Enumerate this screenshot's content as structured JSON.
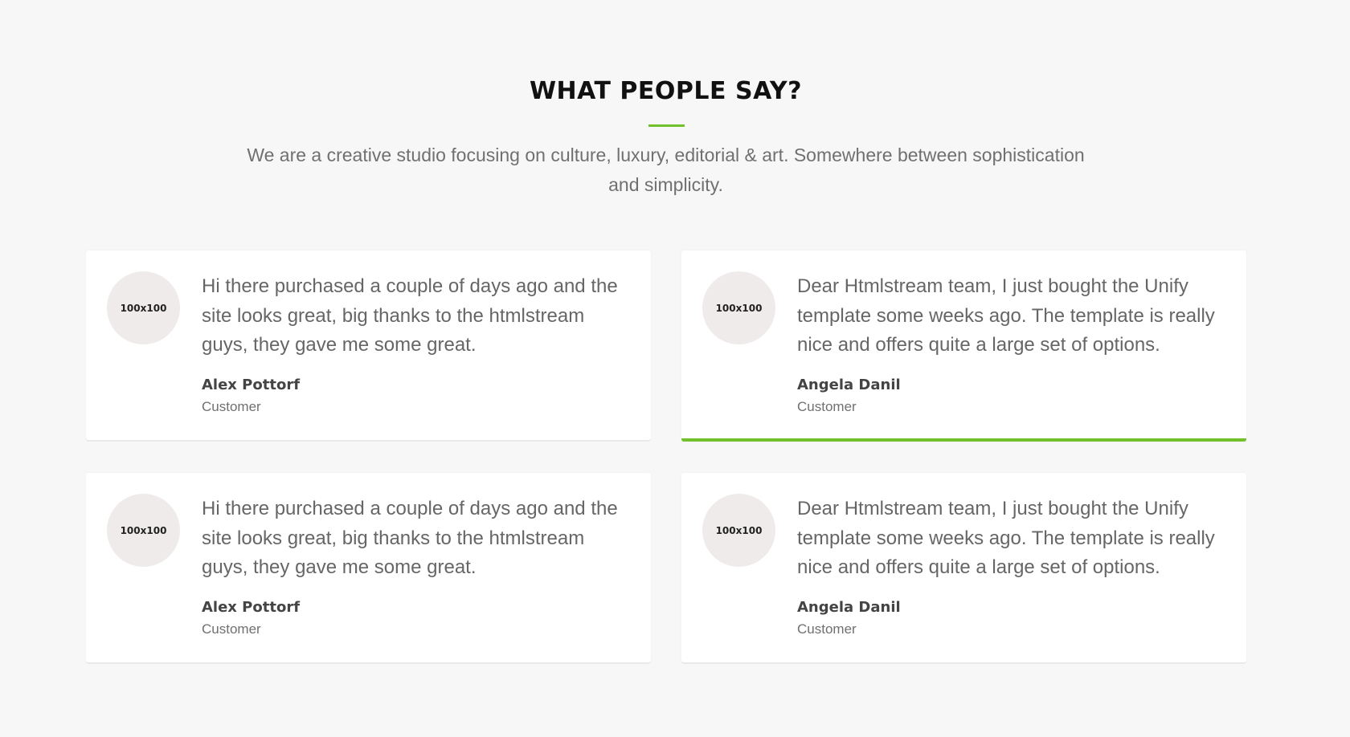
{
  "section": {
    "heading": "WHAT PEOPLE SAY?",
    "intro": "We are a creative studio focusing on culture, luxury, editorial & art. Somewhere between sophistication and simplicity."
  },
  "colors": {
    "accent": "#72c02c",
    "background": "#f7f7f7",
    "card": "#ffffff",
    "avatar_placeholder": "#efebea"
  },
  "testimonials": [
    {
      "avatar_label": "100x100",
      "quote": "Hi there purchased a couple of days ago and the site looks great, big thanks to the htmlstream guys, they gave me some great.",
      "name": "Alex Pottorf",
      "role": "Customer",
      "active": false
    },
    {
      "avatar_label": "100x100",
      "quote": "Dear Htmlstream team, I just bought the Unify template some weeks ago. The template is really nice and offers quite a large set of options.",
      "name": "Angela Danil",
      "role": "Customer",
      "active": true
    },
    {
      "avatar_label": "100x100",
      "quote": "Hi there purchased a couple of days ago and the site looks great, big thanks to the htmlstream guys, they gave me some great.",
      "name": "Alex Pottorf",
      "role": "Customer",
      "active": false
    },
    {
      "avatar_label": "100x100",
      "quote": "Dear Htmlstream team, I just bought the Unify template some weeks ago. The template is really nice and offers quite a large set of options.",
      "name": "Angela Danil",
      "role": "Customer",
      "active": false
    }
  ]
}
